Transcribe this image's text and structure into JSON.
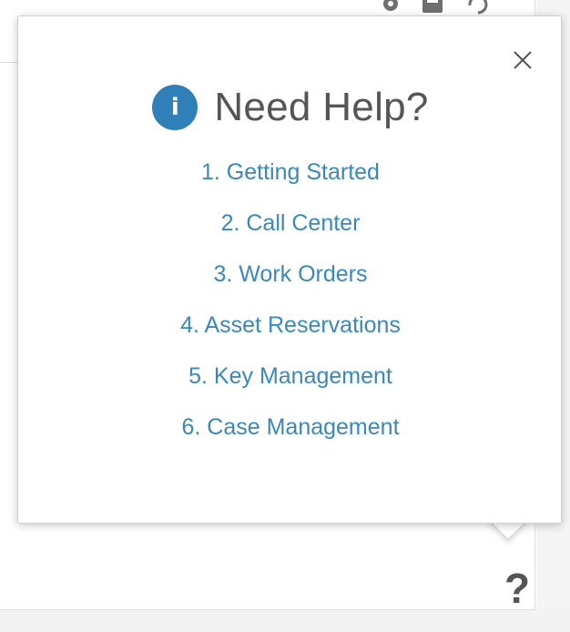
{
  "background": {
    "help_trigger_label": "?",
    "toolbar_icons": [
      "gear-icon",
      "save-icon",
      "refresh-icon"
    ]
  },
  "popover": {
    "title": "Need Help?",
    "info_icon_glyph": "i",
    "links": [
      {
        "label": "1. Getting Started"
      },
      {
        "label": "2. Call Center"
      },
      {
        "label": "3. Work Orders"
      },
      {
        "label": "4. Asset Reservations"
      },
      {
        "label": "5. Key Management"
      },
      {
        "label": "6. Case Management"
      }
    ]
  },
  "colors": {
    "accent": "#2f80b9",
    "link": "#3a88ba",
    "title": "#555555"
  }
}
